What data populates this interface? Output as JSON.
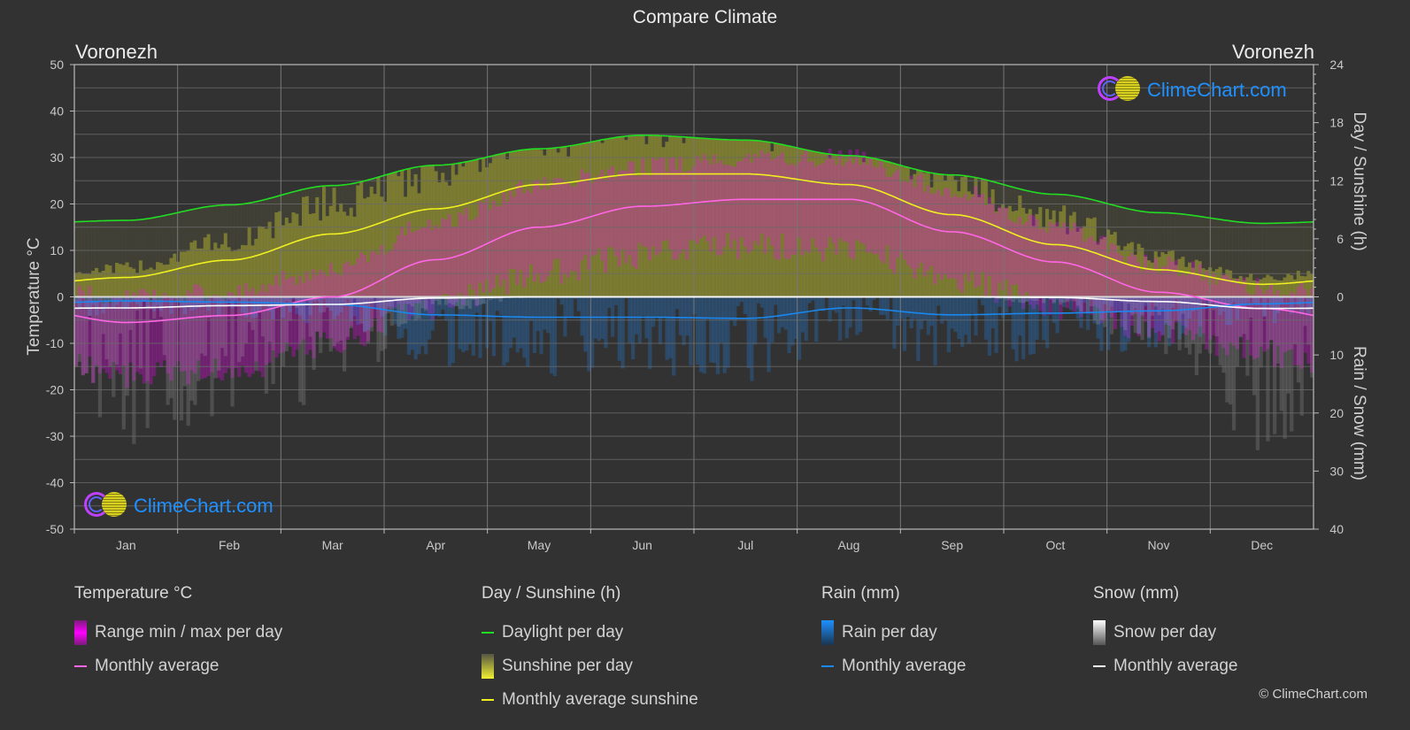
{
  "title": "Compare Climate",
  "location_left": "Voronezh",
  "location_right": "Voronezh",
  "brand": {
    "text": "ClimeChart.com",
    "copyright": "© ClimeChart.com"
  },
  "colors": {
    "background": "#323232",
    "temperature_range": "#ff00ff",
    "temperature_avg": "#ff66e6",
    "daylight": "#22dd22",
    "sunshine_bar": "#e6e61a",
    "sunshine_avg": "#f0f020",
    "rain_bar": "#1e90ff",
    "rain_avg": "#1a88ee",
    "snow_bar": "#cccccc",
    "snow_avg": "#ffffff",
    "brand": "#1e90ff"
  },
  "chart_data": {
    "type": "line",
    "title": "Compare Climate",
    "categories": [
      "Jan",
      "Feb",
      "Mar",
      "Apr",
      "May",
      "Jun",
      "Jul",
      "Aug",
      "Sep",
      "Oct",
      "Nov",
      "Dec"
    ],
    "axes": {
      "left": {
        "label": "Temperature °C",
        "range": [
          -50,
          50
        ],
        "ticks": [
          50,
          40,
          30,
          20,
          10,
          0,
          -10,
          -20,
          -30,
          -40,
          -50
        ]
      },
      "right_top": {
        "label": "Day / Sunshine (h)",
        "range": [
          0,
          24
        ],
        "ticks": [
          24,
          18,
          12,
          6,
          0
        ]
      },
      "right_bottom": {
        "label": "Rain / Snow (mm)",
        "range": [
          0,
          40
        ],
        "ticks": [
          0,
          10,
          20,
          30,
          40
        ]
      }
    },
    "grid": true,
    "series": [
      {
        "name": "Temperature monthly average",
        "axis": "left",
        "unit": "°C",
        "values": [
          -5.5,
          -4.0,
          0.0,
          8.0,
          15.0,
          19.5,
          21.0,
          21.0,
          14.0,
          7.5,
          1.0,
          -2.5
        ]
      },
      {
        "name": "Daylight per day",
        "axis": "right_top",
        "unit": "h",
        "values": [
          7.9,
          9.5,
          11.5,
          13.6,
          15.3,
          16.7,
          16.2,
          14.6,
          12.6,
          10.6,
          8.7,
          7.6
        ]
      },
      {
        "name": "Monthly average sunshine",
        "axis": "right_top",
        "unit": "h",
        "values": [
          2.0,
          3.8,
          6.5,
          9.1,
          11.6,
          12.7,
          12.7,
          11.6,
          8.5,
          5.4,
          2.8,
          1.3
        ]
      },
      {
        "name": "Rain monthly average",
        "axis": "right_bottom",
        "unit": "mm",
        "values": [
          0.7,
          0.9,
          1.3,
          3.1,
          3.5,
          3.5,
          3.7,
          1.9,
          3.1,
          2.8,
          2.4,
          1.2
        ]
      },
      {
        "name": "Snow monthly average",
        "axis": "right_bottom",
        "unit": "mm",
        "values": [
          1.9,
          1.5,
          1.3,
          0.2,
          0.0,
          0.0,
          0.0,
          0.0,
          0.0,
          0.1,
          0.8,
          2.0
        ]
      }
    ],
    "temperature_range_approx": {
      "min": [
        -14,
        -13,
        -7,
        1,
        8,
        12,
        14,
        13,
        7,
        1,
        -4,
        -9
      ],
      "max": [
        -2,
        -1,
        4,
        14,
        22,
        26,
        28,
        28,
        21,
        13,
        5,
        0
      ]
    }
  },
  "legend": {
    "groups": [
      {
        "title": "Temperature °C",
        "items": [
          {
            "type": "swatch",
            "label": "Range min / max per day",
            "color": "#ff00ff"
          },
          {
            "type": "line",
            "label": "Monthly average",
            "color": "#ff66e6"
          }
        ]
      },
      {
        "title": "Day / Sunshine (h)",
        "items": [
          {
            "type": "line",
            "label": "Daylight per day",
            "color": "#22dd22"
          },
          {
            "type": "swatch",
            "label": "Sunshine per day",
            "color": "#e6e61a"
          },
          {
            "type": "line",
            "label": "Monthly average sunshine",
            "color": "#f0f020"
          }
        ]
      },
      {
        "title": "Rain (mm)",
        "items": [
          {
            "type": "swatch",
            "label": "Rain per day",
            "color": "#1e90ff"
          },
          {
            "type": "line",
            "label": "Monthly average",
            "color": "#1a88ee"
          }
        ]
      },
      {
        "title": "Snow (mm)",
        "items": [
          {
            "type": "swatch",
            "label": "Snow per day",
            "color": "#cccccc"
          },
          {
            "type": "line",
            "label": "Monthly average",
            "color": "#ffffff"
          }
        ]
      }
    ]
  }
}
